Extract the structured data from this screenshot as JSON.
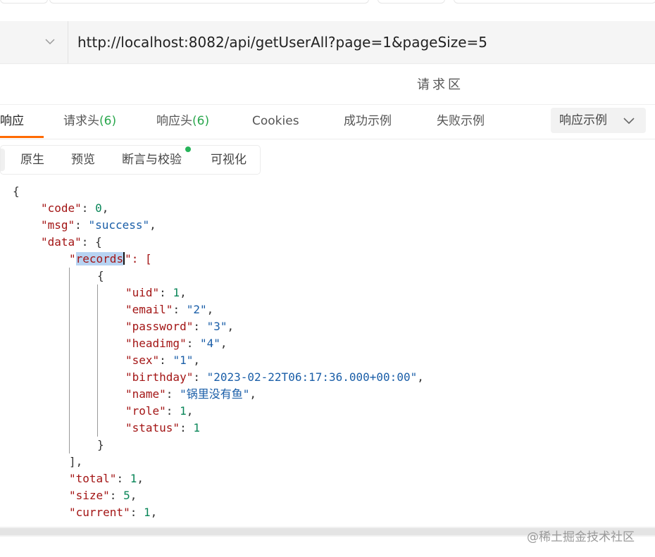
{
  "url": "http://localhost:8082/api/getUserAll?page=1&pageSize=5",
  "section_title": "请求区",
  "tabs": {
    "response": "响应",
    "req_headers": "请求头",
    "req_headers_count": "(6)",
    "resp_headers": "响应头",
    "resp_headers_count": "(6)",
    "cookies": "Cookies",
    "success_example": "成功示例",
    "fail_example": "失败示例"
  },
  "example_select": "响应示例",
  "view_tabs": {
    "raw": "原生",
    "preview": "预览",
    "assert": "断言与校验",
    "visualize": "可视化"
  },
  "json": {
    "open": "{",
    "code_key": "\"code\"",
    "code_val": "0",
    "msg_key": "\"msg\"",
    "msg_val": "\"success\"",
    "data_key": "\"data\"",
    "data_open": "{",
    "records_q": "\"",
    "records_word": "records",
    "records_tail": "\": [",
    "obj_open": "{",
    "uid_key": "\"uid\"",
    "uid_val": "1",
    "email_key": "\"email\"",
    "email_val": "\"2\"",
    "password_key": "\"password\"",
    "password_val": "\"3\"",
    "headimg_key": "\"headimg\"",
    "headimg_val": "\"4\"",
    "sex_key": "\"sex\"",
    "sex_val": "\"1\"",
    "birthday_key": "\"birthday\"",
    "birthday_val": "\"2023-02-22T06:17:36.000+00:00\"",
    "name_key": "\"name\"",
    "name_val": "\"锅里没有鱼\"",
    "role_key": "\"role\"",
    "role_val": "1",
    "status_key": "\"status\"",
    "status_val": "1",
    "obj_close": "}",
    "arr_close": "],",
    "total_key": "\"total\"",
    "total_val": "1",
    "size_key": "\"size\"",
    "size_val": "5",
    "current_key": "\"current\"",
    "current_val": "1"
  },
  "watermark": "@稀土掘金技术社区",
  "colors": {
    "accent": "#ff6a00",
    "count_green": "#2aa74d",
    "json_key": "#a31515",
    "json_string": "#1a5ea8",
    "json_number": "#098658",
    "selection": "#b7d3f2"
  }
}
